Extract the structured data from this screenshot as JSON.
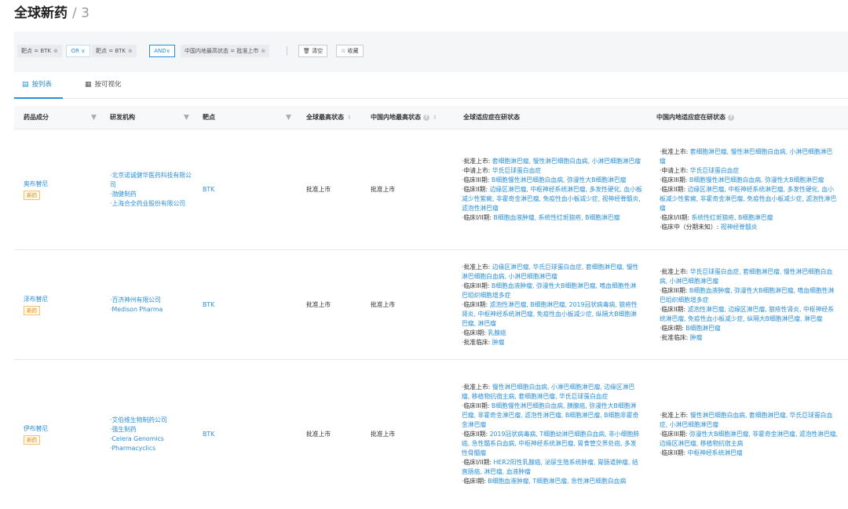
{
  "header": {
    "title": "全球新药",
    "sep_count": "/ 3"
  },
  "filters": {
    "chip1": "靶点 = BTK",
    "or_label": "OR ∨",
    "chip2": "靶点 = BTK",
    "and_label": "AND∨",
    "chip3": "中国内地最高状态 = 批准上市",
    "clear_label": "清空",
    "fav_label": "收藏",
    "remove_glyph": "⊗"
  },
  "tabs": [
    {
      "label": "按列表",
      "icon": "list-icon",
      "active": true
    },
    {
      "label": "按可视化",
      "icon": "grid-icon",
      "active": false
    }
  ],
  "columns": [
    "药品成分",
    "研发机构",
    "靶点",
    "全球最高状态",
    "中国内地最高状态",
    "全球适应症在研状态",
    "中国内地适应症在研状态"
  ],
  "rows": [
    {
      "drug": "奥布替尼",
      "badge": "新药",
      "orgs": [
        "北京诺诚健华医药科技有限公司",
        "渤健制药",
        "上海合全药业股份有限公司"
      ],
      "target": "BTK",
      "global_status": "批准上市",
      "cn_status": "批准上市",
      "global_ind": [
        {
          "stage": "批准上市:",
          "text": "套细胞淋巴瘤, 慢性淋巴细胞白血病, 小淋巴细胞淋巴瘤"
        },
        {
          "stage": "申请上市:",
          "text": "华氏巨球蛋白血症"
        },
        {
          "stage": "临床III期:",
          "text": "B细胞慢性淋巴细胞白血病, 弥漫性大B细胞淋巴瘤"
        },
        {
          "stage": "临床II期:",
          "text": "边缘区淋巴瘤, 中枢神经系统淋巴瘤, 多发性硬化, 血小板减少性紫癜, 非霍奇金淋巴瘤, 免疫性血小板减少症, 视神经脊髓炎, 滤泡性淋巴瘤"
        },
        {
          "stage": "临床I/II期:",
          "text": "B细胞血液肿瘤, 系统性红斑狼疮, B细胞淋巴瘤"
        }
      ],
      "cn_ind": [
        {
          "stage": "批准上市:",
          "text": "套细胞淋巴瘤, 慢性淋巴细胞白血病, 小淋巴细胞淋巴瘤"
        },
        {
          "stage": "申请上市:",
          "text": "华氏巨球蛋白血症"
        },
        {
          "stage": "临床III期:",
          "text": "B细胞慢性淋巴细胞白血病, 弥漫性大B细胞淋巴瘤"
        },
        {
          "stage": "临床II期:",
          "text": "边缘区淋巴瘤, 中枢神经系统淋巴瘤, 多发性硬化, 血小板减少性紫癜, 非霍奇金淋巴瘤, 免疫性血小板减少症, 滤泡性淋巴瘤"
        },
        {
          "stage": "临床I/II期:",
          "text": "系统性红斑狼疮, B细胞淋巴瘤"
        },
        {
          "stage": "临床中（分期未知）:",
          "text": "视神经脊髓炎"
        }
      ]
    },
    {
      "drug": "泽布替尼",
      "badge": "新药",
      "orgs": [
        "百济神州有限公司",
        "Medison Pharma"
      ],
      "target": "BTK",
      "global_status": "批准上市",
      "cn_status": "批准上市",
      "global_ind": [
        {
          "stage": "批准上市:",
          "text": "边缘区淋巴瘤, 华氏巨球蛋白血症, 套细胞淋巴瘤, 慢性淋巴细胞白血病, 小淋巴细胞淋巴瘤"
        },
        {
          "stage": "临床III期:",
          "text": "B细胞血液肿瘤, 弥漫性大B细胞淋巴瘤, 嗜血细胞性淋巴组织细胞增多症"
        },
        {
          "stage": "临床II期:",
          "text": "滤泡性淋巴瘤, B细胞淋巴瘤, 2019冠状病毒病, 狼疮性肾炎, 中枢神经系统淋巴瘤, 免疫性血小板减少症, 纵隔大B细胞淋巴瘤, 淋巴瘤"
        },
        {
          "stage": "临床I期:",
          "text": "乳腺癌"
        },
        {
          "stage": "批准临床:",
          "text": "肿瘤"
        }
      ],
      "cn_ind": [
        {
          "stage": "批准上市:",
          "text": "华氏巨球蛋白血症, 套细胞淋巴瘤, 慢性淋巴细胞白血病, 小淋巴细胞淋巴瘤"
        },
        {
          "stage": "临床III期:",
          "text": "B细胞血液肿瘤, 弥漫性大B细胞淋巴瘤, 嗜血细胞性淋巴组织细胞增多症"
        },
        {
          "stage": "临床II期:",
          "text": "滤泡性淋巴瘤, 边缘区淋巴瘤, 狼疮性肾炎, 中枢神经系统淋巴瘤, 免疫性血小板减少症, 纵隔大B细胞淋巴瘤, 淋巴瘤"
        },
        {
          "stage": "临床I期:",
          "text": "B细胞淋巴瘤"
        },
        {
          "stage": "批准临床:",
          "text": "肿瘤"
        }
      ]
    },
    {
      "drug": "伊布替尼",
      "badge": "新药",
      "orgs": [
        "艾伯维生物制药公司",
        "强生制药",
        "Celera Genomics",
        "Pharmacyclics"
      ],
      "target": "BTK",
      "global_status": "批准上市",
      "cn_status": "批准上市",
      "global_ind": [
        {
          "stage": "批准上市:",
          "text": "慢性淋巴细胞白血病, 小淋巴细胞淋巴瘤, 边缘区淋巴瘤, 移植物抗宿主病, 套细胞淋巴瘤, 华氏巨球蛋白血症"
        },
        {
          "stage": "临床III期:",
          "text": "B细胞慢性淋巴细胞白血病, 胰腺癌, 弥漫性大B细胞淋巴瘤, 非霍奇金淋巴瘤, 滤泡性淋巴瘤, B细胞淋巴瘤, B细胞非霍奇金淋巴瘤"
        },
        {
          "stage": "临床II期:",
          "text": "2019冠状病毒病, T细胞幼淋巴细胞白血病, 非小细胞肺癌, 急性髓系白血病, 中枢神经系统淋巴瘤, 胃食管交界处癌, 多发性骨髓瘤"
        },
        {
          "stage": "临床I/II期:",
          "text": "HER2阳性乳腺癌, 泌尿生殖系统肿瘤, 胃肠道肿瘤, 结直肠癌, 淋巴瘤, 血液肿瘤"
        },
        {
          "stage": "临床I期:",
          "text": "B细胞血液肿瘤, T细胞淋巴瘤, 急性淋巴细胞白血病"
        }
      ],
      "cn_ind": [
        {
          "stage": "批准上市:",
          "text": "慢性淋巴细胞白血病, 套细胞淋巴瘤, 华氏巨球蛋白血症, 小淋巴细胞淋巴瘤"
        },
        {
          "stage": "临床III期:",
          "text": "弥漫性大B细胞淋巴瘤, 非霍奇金淋巴瘤, 滤泡性淋巴瘤, 边缘区淋巴瘤, 移植物抗宿主病"
        },
        {
          "stage": "临床II期:",
          "text": "中枢神经系统淋巴瘤"
        }
      ]
    }
  ]
}
